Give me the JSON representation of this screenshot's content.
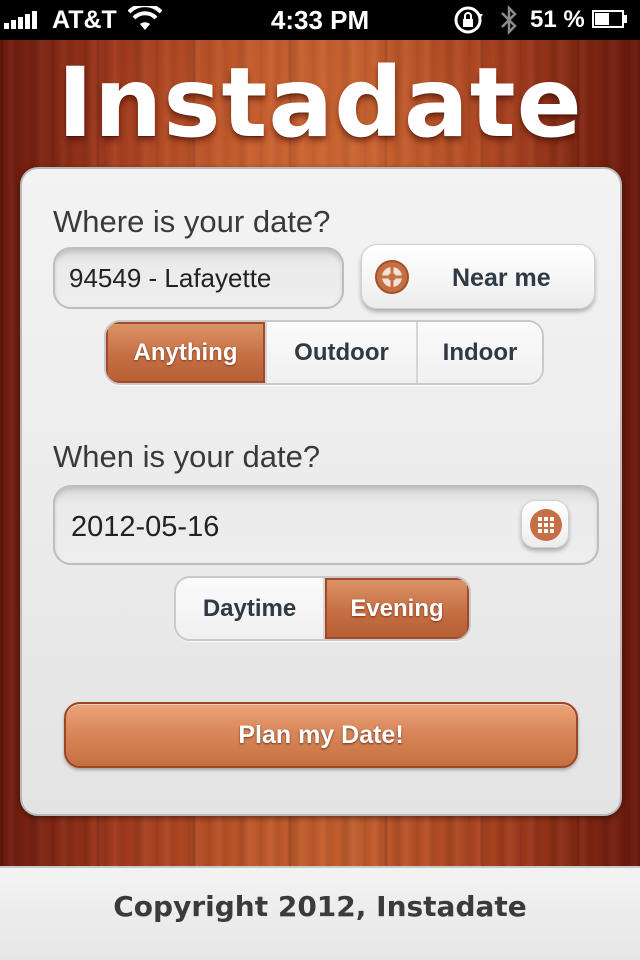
{
  "status_bar": {
    "carrier": "AT&T",
    "time": "4:33 PM",
    "battery_percent": "51 %",
    "icons": [
      "signal-icon",
      "wifi-icon",
      "rotation-lock-icon",
      "bluetooth-icon",
      "battery-icon"
    ]
  },
  "app": {
    "logo_text": "Instadate"
  },
  "where": {
    "label": "Where is your date?",
    "location_value": "94549 - Lafayette",
    "near_me_label": "Near me",
    "near_me_icon": "crosshair-icon",
    "venue_options": [
      "Anything",
      "Outdoor",
      "Indoor"
    ],
    "selected_venue": "Anything"
  },
  "when": {
    "label": "When is your date?",
    "date_value": "2012-05-16",
    "calendar_icon": "calendar-icon",
    "time_options": [
      "Daytime",
      "Evening"
    ],
    "selected_time": "Evening"
  },
  "actions": {
    "plan_label": "Plan my Date!"
  },
  "footer": {
    "copyright": "Copyright 2012, Instadate"
  },
  "colors": {
    "accent": "#c66f44",
    "accent_border": "#9e4526",
    "wood_mid": "#c25a2c",
    "wood_dark": "#6d1a0d"
  }
}
